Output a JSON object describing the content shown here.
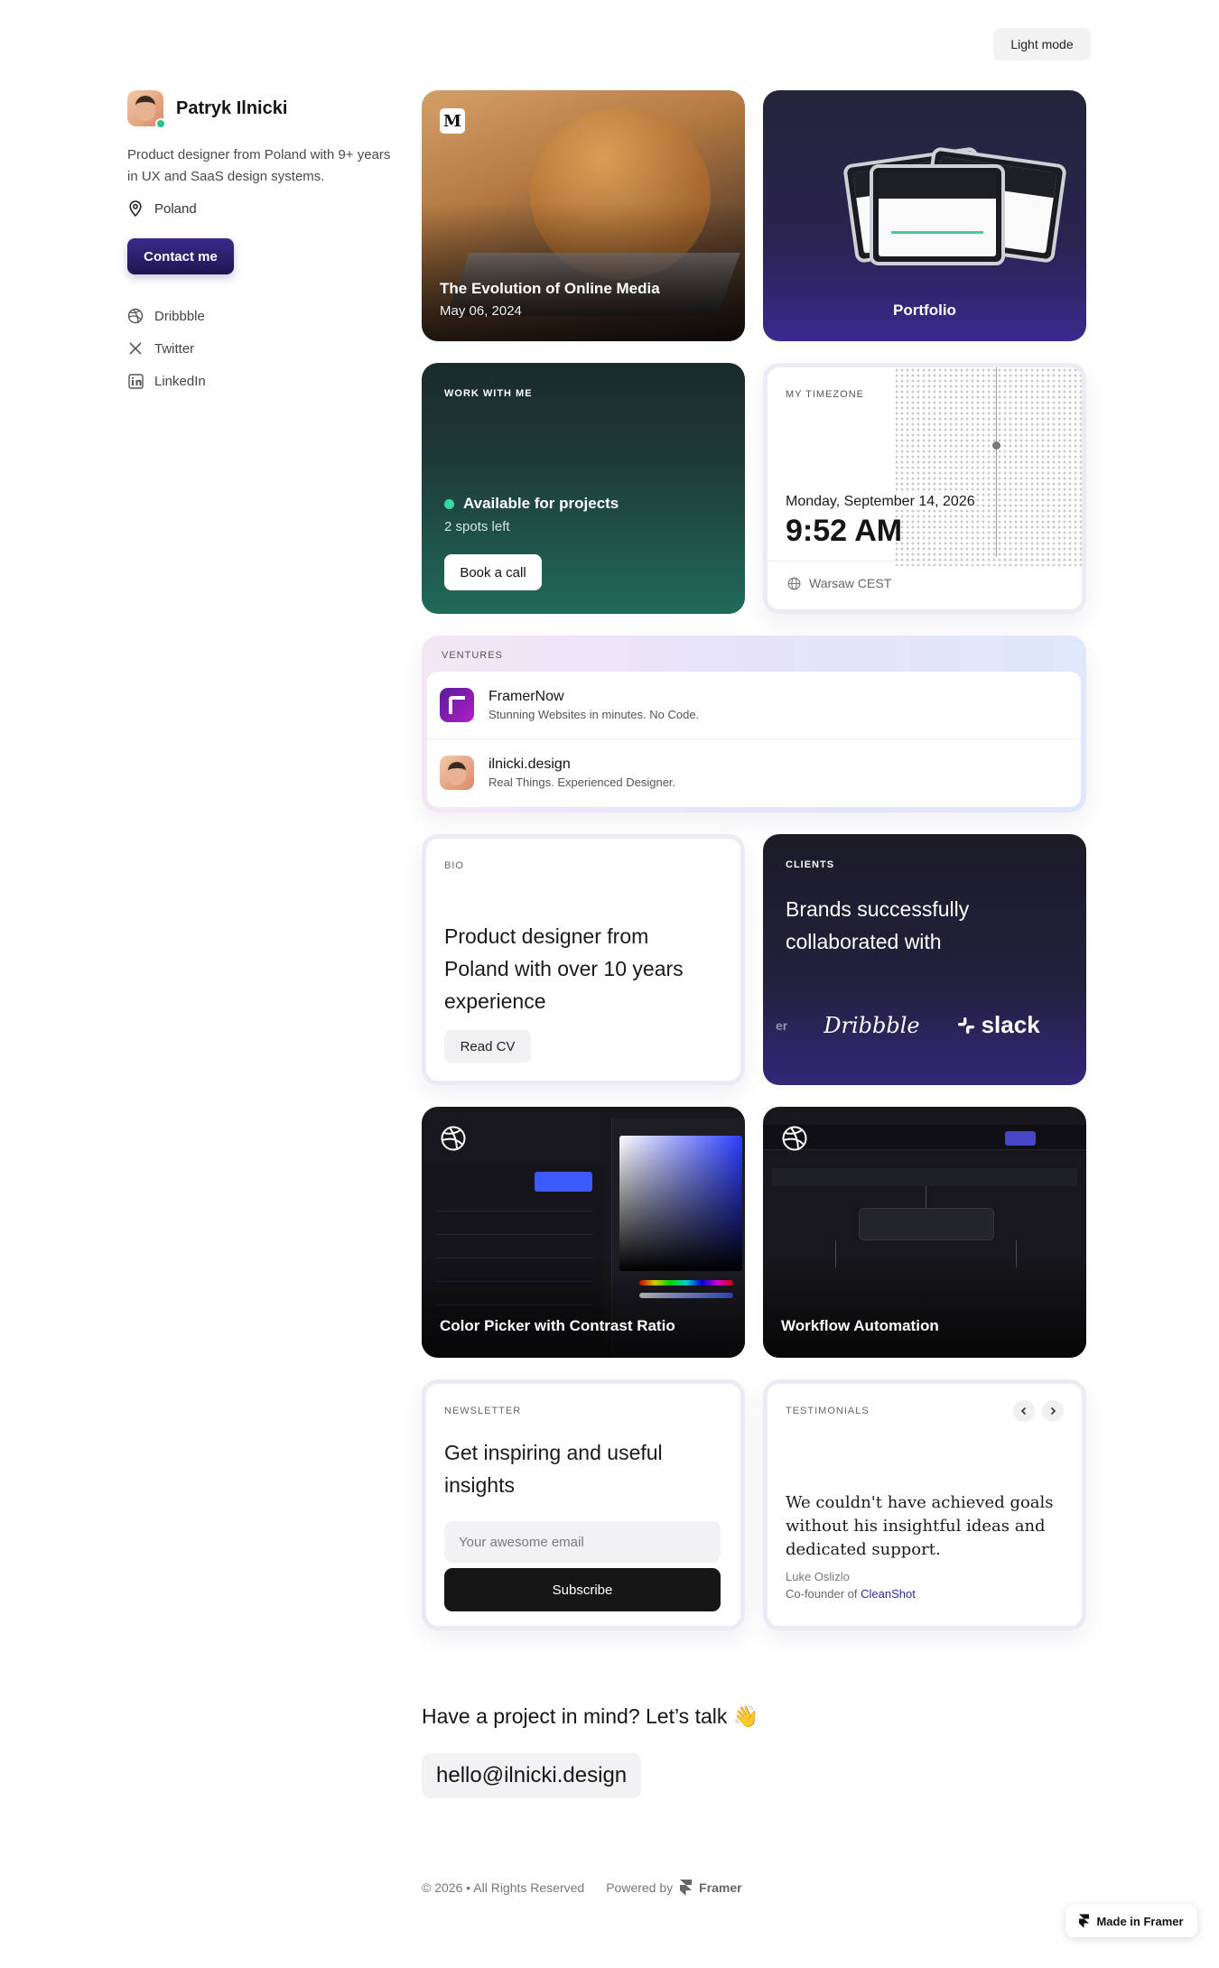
{
  "header": {
    "mode_toggle": "Light mode"
  },
  "profile": {
    "name": "Patryk Ilnicki",
    "bio": "Product designer from Poland with 9+ years in UX and SaaS design systems.",
    "location": "Poland",
    "contact_label": "Contact me",
    "socials": [
      {
        "label": "Dribbble",
        "icon": "dribbble-icon"
      },
      {
        "label": "Twitter",
        "icon": "x-icon"
      },
      {
        "label": "LinkedIn",
        "icon": "linkedin-icon"
      }
    ]
  },
  "cards": {
    "media": {
      "title": "The Evolution of Online Media",
      "date": "May 06, 2024",
      "logo": "M"
    },
    "portfolio": {
      "title": "Portfolio"
    },
    "work": {
      "label": "Work with me",
      "status": "Available for projects",
      "spots": "2 spots left",
      "button": "Book a call"
    },
    "timezone": {
      "label": "My timezone",
      "date": "Monday, September 14, 2026",
      "time": "9:52 AM",
      "city": "Warsaw CEST"
    },
    "ventures": {
      "label": "Ventures",
      "items": [
        {
          "title": "FramerNow",
          "desc": "Stunning Websites in minutes. No Code."
        },
        {
          "title": "ilnicki.design",
          "desc": "Real Things. Experienced Designer."
        }
      ]
    },
    "bio": {
      "label": "Bio",
      "text": "Product designer from Poland with over 10 years experience",
      "button": "Read CV"
    },
    "clients": {
      "label": "Clients",
      "text": "Brands successfully collaborated with",
      "logos": [
        "er",
        "Dribbble",
        "slack"
      ]
    },
    "color_picker": {
      "title": "Color Picker with Contrast Ratio"
    },
    "workflow": {
      "title": "Workflow Automation"
    },
    "newsletter": {
      "label": "Newsletter",
      "text": "Get inspiring and useful insights",
      "placeholder": "Your awesome email",
      "button": "Subscribe"
    },
    "testimonials": {
      "label": "Testimonials",
      "quote": "We couldn't have achieved goals without his insightful ideas and dedicated support.",
      "author": "Luke Oslizlo",
      "role_prefix": "Co-founder of ",
      "company": "CleanShot"
    }
  },
  "cta": {
    "text": "Have a project in mind? Let’s talk 👋",
    "email": "hello@ilnicki.design"
  },
  "footer": {
    "copyright": "© 2026 • All Rights Reserved",
    "powered_by": "Powered by",
    "framer": "Framer"
  },
  "badge": {
    "made_in": "Made in Framer"
  },
  "colors": {
    "accent": "#2c2b9c",
    "available": "#3ad8a0",
    "contact_button": "#2a1f6e"
  }
}
